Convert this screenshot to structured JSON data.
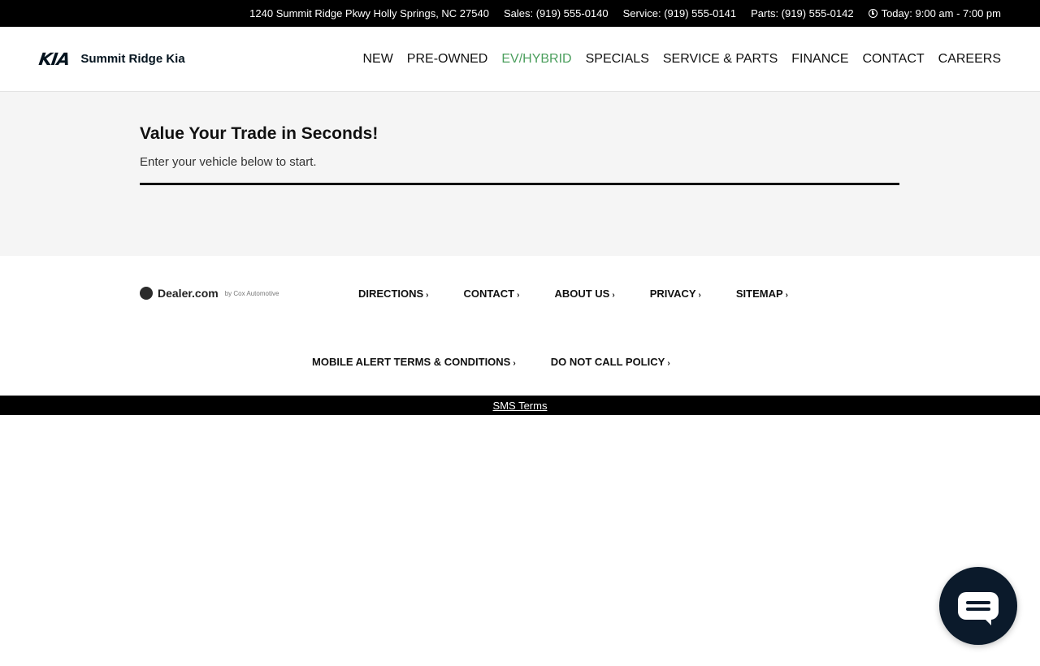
{
  "topbar": {
    "address": "1240 Summit Ridge Pkwy Holly Springs, NC 27540",
    "sales": "Sales: (919) 555-0140",
    "service": "Service: (919) 555-0141",
    "parts": "Parts: (919) 555-0142",
    "hours": "Today: 9:00 am - 7:00 pm",
    "hours_icon": "clock-icon"
  },
  "header": {
    "logo_text": "KIA",
    "dealer_name": "Summit Ridge Kia",
    "nav": [
      {
        "label": "NEW"
      },
      {
        "label": "PRE-OWNED"
      },
      {
        "label": "EV/HYBRID",
        "active": true
      },
      {
        "label": "SPECIALS"
      },
      {
        "label": "SERVICE & PARTS"
      },
      {
        "label": "FINANCE"
      },
      {
        "label": "CONTACT"
      },
      {
        "label": "CAREERS"
      }
    ]
  },
  "trade": {
    "title": "Value Your Trade in Seconds!",
    "subtitle": "Enter your vehicle below to start."
  },
  "footer": {
    "dealercom": "Dealer.com",
    "dealercom_by": "by Cox Automotive",
    "links_row1": [
      "DIRECTIONS",
      "CONTACT",
      "ABOUT US",
      "PRIVACY",
      "SITEMAP"
    ],
    "links_row2": [
      "MOBILE ALERT TERMS & CONDITIONS",
      "DO NOT CALL POLICY"
    ],
    "chevron": "›"
  },
  "bottom": {
    "sms_terms": "SMS Terms"
  },
  "chat": {
    "icon": "chat-bubble-icon"
  },
  "colors": {
    "accent_green": "#4a9e5c",
    "topbar_bg": "#000000",
    "section_bg": "#f5f5f5",
    "chat_bg": "#0b1a2b"
  }
}
